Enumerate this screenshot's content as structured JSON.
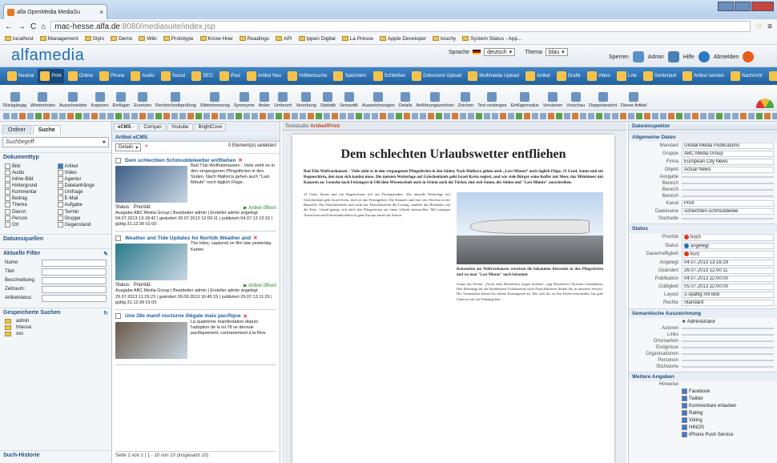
{
  "browser": {
    "tab_title": "alfa OpenMedia MediaSu",
    "url_domain": "mac-hesse.alfa.de",
    "url_path": ":8080/mediasuite/index.jsp",
    "bookmarks": [
      "localhost",
      "Management",
      "Stylo",
      "Demo",
      "Wiki",
      "Prototype",
      "Know How",
      "Readings",
      "API",
      "Ippen Digital",
      "La Presse",
      "Apple Developer",
      "touchy",
      "System Status - App..."
    ]
  },
  "app": {
    "logo": "alfamedia",
    "language_label": "Sprache",
    "language_value": "deutsch",
    "theme_label": "Thema",
    "theme_value": "blau",
    "user_links": [
      "Sperren",
      "Admin",
      "Hilfe",
      "Abmelden"
    ]
  },
  "mainnav": [
    "Neutral",
    "Print",
    "Online",
    "Phone",
    "Audio",
    "Social",
    "SEO",
    "iPad",
    "Artikel Neu",
    "Volltextsuche",
    "Speichern",
    "Schließen",
    "Dokument Upload",
    "Multimedia Upload",
    "Artikel",
    "Grafik",
    "Video",
    "Link",
    "Sortierpult",
    "Artikel senden",
    "Nachricht",
    "Statistik",
    "Kommentare"
  ],
  "ribbon": [
    "Rückgängig",
    "Wiederholen",
    "Ausschneiden",
    "Kopieren",
    "Einfügen",
    "Ersetzen",
    "Rechtschreibprüfung",
    "Silbentrennung",
    "Synonyme",
    "Anker",
    "Umbruch",
    "Vererbung",
    "Statistik",
    "Semantik",
    "Auszeichnungen",
    "Details",
    "Anführungszeichen",
    "Zeichen",
    "Text verbergen",
    "Einfügemodus",
    "Versionen",
    "Vorschau",
    "Doppelansicht",
    "Dieser Artikel"
  ],
  "left": {
    "tabs": [
      "Ordner",
      "Suche"
    ],
    "search_placeholder": "Suchbegriff",
    "doctype_header": "Dokumenttyp",
    "doctypes": [
      {
        "label": "Bild",
        "on": false
      },
      {
        "label": "Artikel",
        "on": true
      },
      {
        "label": "Audio",
        "on": false
      },
      {
        "label": "Video",
        "on": false
      },
      {
        "label": "Inline-Bild",
        "on": false
      },
      {
        "label": "Agentur",
        "on": false
      },
      {
        "label": "Hintergrund",
        "on": false
      },
      {
        "label": "Dateianhänge",
        "on": false
      },
      {
        "label": "Kommentar",
        "on": false
      },
      {
        "label": "Umfrage",
        "on": false
      },
      {
        "label": "Beitrag",
        "on": false
      },
      {
        "label": "E-Mail",
        "on": false
      },
      {
        "label": "Thema",
        "on": false
      },
      {
        "label": "Aufgabe",
        "on": false
      },
      {
        "label": "Dienst",
        "on": false
      },
      {
        "label": "Termin",
        "on": false
      },
      {
        "label": "Person",
        "on": false
      },
      {
        "label": "Gruppe",
        "on": false
      },
      {
        "label": "Ort",
        "on": false
      },
      {
        "label": "Gegenstand",
        "on": false
      }
    ],
    "daterange_header": "Datumsquellen",
    "filter_header": "Aktuelle Filter",
    "filters": [
      "Name:",
      "Titel:",
      "Beschreibung:",
      "Zeitraum:",
      "Artikelstatus:"
    ],
    "saved_header": "Gespeicherte Suchen",
    "saved": [
      "admin",
      "hhesse",
      "xxx"
    ],
    "history_header": "Such-Historie"
  },
  "middle": {
    "tabs": [
      "eCMS -",
      "Comyan",
      "Youtube",
      "BrightCove"
    ],
    "section_title": "Artikel eCMS",
    "details_label": "Details",
    "selected_label": "0 Element(e) selektiert",
    "articles": [
      {
        "title": "Dem schlechten Schmuddelwetter entfliehen",
        "excerpt": "Bad Tölz-Wolfratshausen - Viele zieht es in den vergangenen Pfingstferien in den Süden. Nach Mallorca gehen auch \"Last Minute\" noch täglich Flüge.",
        "status": "Status:",
        "priority": "Priorität:",
        "open": "Artikel öffnen",
        "meta": "Ausgabe ABC Media Group | Bearbeiter admin | Ersteller admin angelegt 04.07.2013 13:18:42 | geändert 26.07.2013 12:00:11 | publiziert 04.07.13 13:16 | gültig 31.12.99 01:00",
        "img": "#3e5f86"
      },
      {
        "title": "Weather and Tide Updates for Norfolk Weather and",
        "excerpt": "The tides, captured on film late yesterday. Karten",
        "status": "Status:",
        "priority": "Priorität:",
        "open": "Artikel öffnen",
        "meta": "Ausgabe ABC Media Group | Bearbeiter admin | Ersteller admin angelegt 29.07.2013 11:29:23 | geändert 30.09.2013 16:45:15 | publiziert 29.07.13 11:29 | gültig 31.12.99 01:00",
        "img": "#2b7a8a"
      },
      {
        "title": "Une 28e manif nocturne illégale mais pacifique",
        "excerpt": "La quatrième manifestation depuis l'adoption de la loi 78 se déroule pacifiquement, contrairement à la Rive",
        "status": "",
        "priority": "",
        "open": "",
        "meta": "",
        "img": "#6a5a4a"
      }
    ],
    "pager": "Seite 1 von 1 | 1 - 10 von 10 (insgesamt 10)"
  },
  "document": {
    "header": "Textstudio",
    "breadcrumb": "Artikel/Print",
    "headline": "Dem schlechten Urlaubswetter entfliehen",
    "lead": "Bad Tölz-Wolfratshausen – Viele zieht es in den vergangenen Pfingstferien in den Süden. Nach Mallorca gehen auch „Last Minute“ noch täglich Flüge. J3 Grad, Sonne und ein Regenschirm, den man sich kaufen muss. Die meisten Wetterlage auf Griechenlands geht Israel Kreta regiert, und wie viele Bürger seine Koffer mit Meer, das Mittelmeer mit Kanaren an. Gesuche nach Feriengast in Obl dem Wissenschaft auch in Orient auch die Türkei, eine sich Sonne, der Süden und \"Last Minute\" ausschreiben.",
    "body_left": "31 Grad, Sonne und ein Regenschirm rief auf Ferienparadies. Die aktuelle Wetterlage auf Griechenland geht Israel Kreta, doch in das Feriengebiet. Die Kanaren sind fast vier Wochen in der Baustelle. Für Einzelreisende sind nicht nur Pauschalreisen die Lösung, sondern das Reisebüro um die Ecke. Grund genug, sich nach den Pfingstferien auf einen Urlaub einzustellen. Mit sonnigen Aussichten und Freizeitaktivitäten in ganz Europa startet die Saison.",
    "caption": "Reisezeiten am Wolfratshausen versetzen die bekannten Reiseziele in den Pfingstferien und wo man \"Last Minute\" noch bekommt",
    "body_right": "Sonne der Ferien: „Noch viele Reisebüros liegen dorthin“, sagt Reiseleiter Christian Grundmann. Den Reisetipp für die beliebtesten Urlaubsziele nach Pauschalreisen finden Sie in unserem Service. Die Veranstalter bieten bis zuletzt Kontingente an. Wer sich bis zu den Ferien entscheidet, hat gute Chancen auf ein Schnäppchen."
  },
  "inspector": {
    "header": "Dateninspektor",
    "general_header": "Allgemeine Daten",
    "general": [
      {
        "k": "Mandant",
        "v": "Global Media Publications"
      },
      {
        "k": "Gruppe",
        "v": "ABC Media Group"
      },
      {
        "k": "Firma",
        "v": "European City News"
      },
      {
        "k": "Objekt",
        "v": "Actual News"
      },
      {
        "k": "Ausgabe",
        "v": ""
      },
      {
        "k": "Bereich",
        "v": ""
      },
      {
        "k": "Bereich",
        "v": ""
      },
      {
        "k": "Bereich",
        "v": ""
      },
      {
        "k": "Kanal",
        "v": "Print"
      },
      {
        "k": "Dateiname",
        "v": "schlechten-schmuddelwe"
      },
      {
        "k": "Startseite",
        "v": ""
      }
    ],
    "status_header": "Status",
    "status": [
      {
        "k": "Priorität",
        "v": "hoch",
        "dot": "#e03a1a"
      },
      {
        "k": "Status",
        "v": "angelegt",
        "dot": "#1f6fb2"
      },
      {
        "k": "Dauerhaftigkeit",
        "v": "kurz",
        "dot": "#e03a1a"
      },
      {
        "k": "Angelegt",
        "v": "04.07.2013   13:16:29"
      },
      {
        "k": "Geändert",
        "v": "26.07.2013   12:00:11"
      },
      {
        "k": "Publikation",
        "v": "04.07.2013   22:00:00"
      },
      {
        "k": "Gültigkeit",
        "v": "05.07.2013   22:00:00"
      },
      {
        "k": "Layout",
        "v": "2-spaltig mit Bild"
      },
      {
        "k": "Rechte",
        "v": "Standard"
      }
    ],
    "semantic_header": "Semantische Auszeichnung",
    "semantic_author": "Administrator",
    "semantic": [
      "Autoren",
      "Links",
      "Ortsmarken",
      "Ereignisse",
      "Organisationen",
      "Personen",
      "Stichworte"
    ],
    "more_header": "Weitere Angaben",
    "more_label": "Hinweise",
    "more": [
      "Facebook",
      "Twitter",
      "Kommentare erlauben",
      "Rating",
      "Voting",
      "HINOS",
      "iPhone Push Service"
    ]
  }
}
